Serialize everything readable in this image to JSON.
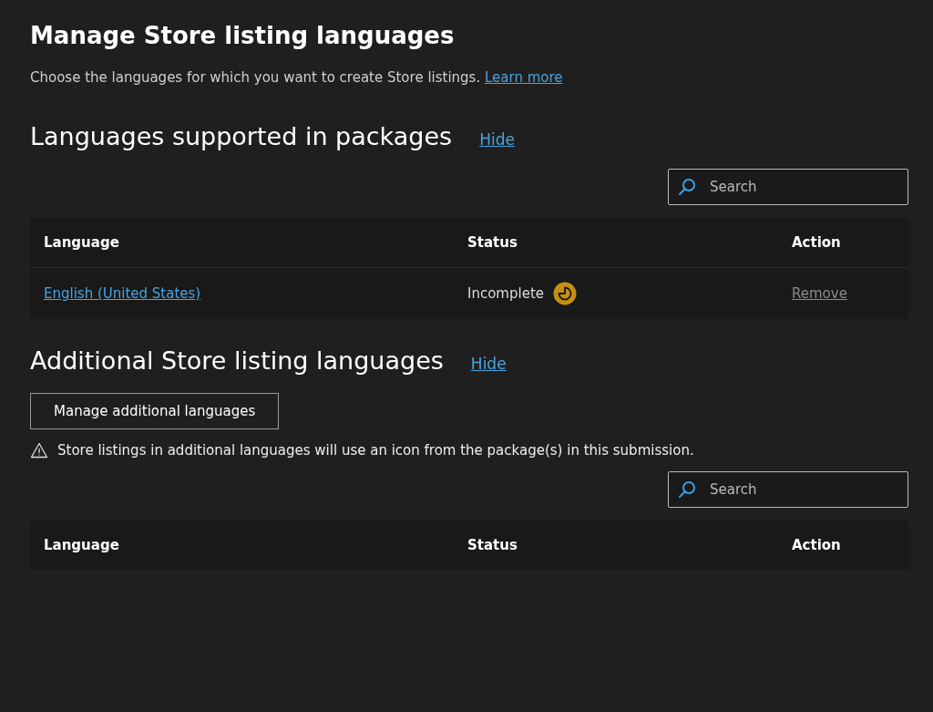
{
  "title": "Manage Store listing languages",
  "intro": {
    "text": "Choose the languages for which you want to create Store listings.",
    "link": "Learn more"
  },
  "sections": [
    {
      "heading": "Languages supported in packages",
      "toggle": "Hide",
      "search": {
        "placeholder": "Search"
      },
      "columns": [
        "Language",
        "Status",
        "Action"
      ],
      "rows": [
        {
          "language": "English (United States)",
          "status": "Incomplete",
          "color": "#c58f12",
          "action": "Remove",
          "disabled": true
        }
      ]
    },
    {
      "heading": "Additional Store listing languages",
      "toggle": "Hide",
      "button": "Manage additional languages",
      "warning": "Store listings in additional languages will use an icon from the package(s) in this submission.",
      "search": {
        "placeholder": "Search"
      },
      "columns": [
        "Language",
        "Status",
        "Action"
      ]
    }
  ]
}
